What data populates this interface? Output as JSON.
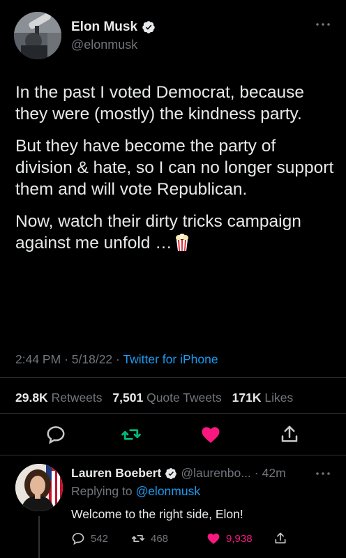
{
  "tweet": {
    "author_name": "Elon Musk",
    "author_handle": "@elonmusk",
    "paragraphs": [
      "In the past I voted Democrat, because they were (mostly) the kindness party.",
      "But they have become the party of division & hate, so I can no longer support them and will vote Republican.",
      "Now, watch their dirty tricks campaign against me unfold …"
    ],
    "time": "2:44 PM",
    "date": "5/18/22",
    "source": "Twitter for iPhone",
    "separator": "·",
    "stats": {
      "retweets_count": "29.8K",
      "retweets_label": "Retweets",
      "quotes_count": "7,501",
      "quotes_label": "Quote Tweets",
      "likes_count": "171K",
      "likes_label": "Likes"
    },
    "icons": [
      "reply-icon",
      "retweet-icon",
      "like-icon",
      "share-icon"
    ],
    "colors": {
      "link": "#1d9bf0",
      "retweet": "#00ba7c",
      "like": "#f91880",
      "background": "#000000"
    }
  },
  "reply": {
    "author_name": "Lauren Boebert",
    "author_handle": "@laurenbo...",
    "separator": "·",
    "age": "42m",
    "replying_label": "Replying to",
    "replying_to": "@elonmusk",
    "text": "Welcome to the right side, Elon!",
    "reply_count": "542",
    "retweet_count": "468",
    "like_count": "9,938"
  }
}
